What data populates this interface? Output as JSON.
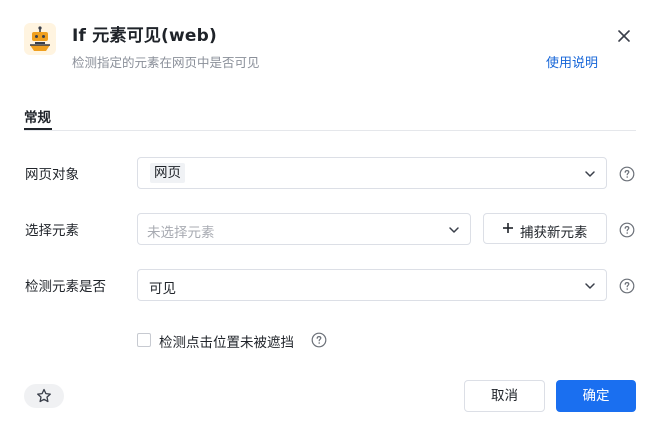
{
  "header": {
    "icon": "robot-icon",
    "title": "If 元素可见(web)",
    "subtitle": "检测指定的元素在网页中是否可见",
    "help_link": "使用说明"
  },
  "tabs": [
    {
      "label": "常规",
      "active": true
    }
  ],
  "form": {
    "web_object": {
      "label": "网页对象",
      "value": "网页"
    },
    "select_element": {
      "label": "选择元素",
      "placeholder": "未选择元素",
      "capture_button": "捕获新元素"
    },
    "check_state": {
      "label": "检测元素是否",
      "value": "可见"
    },
    "check_click": {
      "label": "检测点击位置未被遮挡",
      "checked": false
    }
  },
  "footer": {
    "favorite_icon": "star-icon",
    "cancel": "取消",
    "confirm": "确定"
  },
  "colors": {
    "primary": "#1a6ff0",
    "link": "#1565d8",
    "icon_bg": "#fff4e0",
    "icon_accent": "#f0a020"
  }
}
